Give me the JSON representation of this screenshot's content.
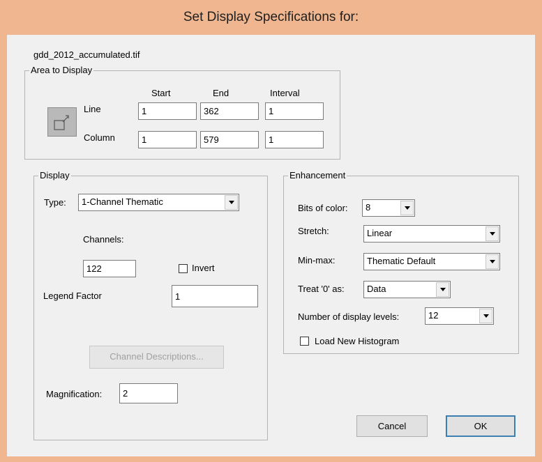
{
  "dialog": {
    "title": "Set Display Specifications for:"
  },
  "file_name": "gdd_2012_accumulated.tif",
  "area": {
    "legend": "Area to Display",
    "headers": {
      "start": "Start",
      "end": "End",
      "interval": "Interval"
    },
    "line": {
      "label": "Line",
      "start": "1",
      "end": "362",
      "interval": "1"
    },
    "column": {
      "label": "Column",
      "start": "1",
      "end": "579",
      "interval": "1"
    }
  },
  "display": {
    "legend": "Display",
    "type_label": "Type:",
    "type_value": "1-Channel Thematic",
    "channels_label": "Channels:",
    "channels_value": "122",
    "invert_label": "Invert",
    "invert_checked": false,
    "legend_factor_label": "Legend Factor",
    "legend_factor_value": "1",
    "channel_descriptions_label": "Channel Descriptions...",
    "magnification_label": "Magnification:",
    "magnification_value": "2"
  },
  "enhancement": {
    "legend": "Enhancement",
    "bits_label": "Bits of color:",
    "bits_value": "8",
    "stretch_label": "Stretch:",
    "stretch_value": "Linear",
    "minmax_label": "Min-max:",
    "minmax_value": "Thematic Default",
    "treat_zero_label": "Treat '0' as:",
    "treat_zero_value": "Data",
    "levels_label": "Number of display levels:",
    "levels_value": "12",
    "load_histogram_label": "Load New Histogram",
    "load_histogram_checked": false
  },
  "buttons": {
    "cancel": "Cancel",
    "ok": "OK"
  },
  "colors": {
    "frame": "#efb690",
    "client": "#f0f0f0",
    "default_button_border": "#3c7fb1"
  }
}
